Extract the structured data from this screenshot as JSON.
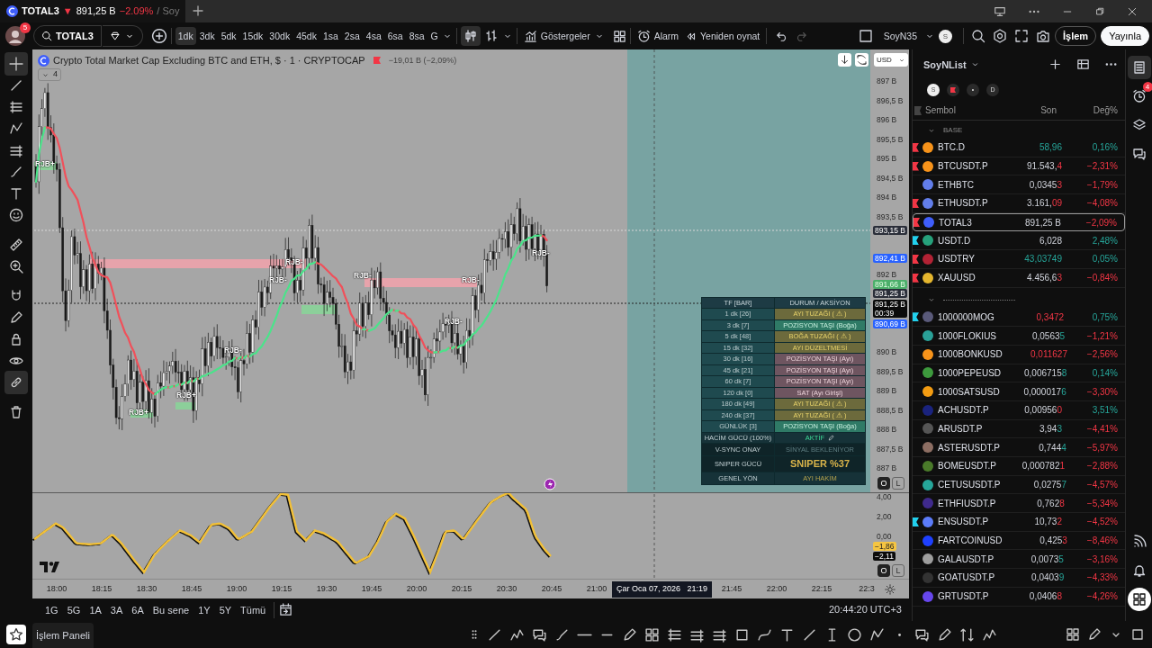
{
  "browser_tab": {
    "symbol": "TOTAL3",
    "arrow": "▼",
    "price": "891,25 B",
    "change": "−2.09%",
    "suffix": "/ Soy"
  },
  "header": {
    "avatar_badge": "5",
    "symbol": "TOTAL3",
    "timeframes": [
      {
        "label": "1dk",
        "selected": true
      },
      {
        "label": "3dk",
        "selected": false
      },
      {
        "label": "5dk",
        "selected": false
      },
      {
        "label": "15dk",
        "selected": false
      },
      {
        "label": "30dk",
        "selected": false
      },
      {
        "label": "45dk",
        "selected": false
      },
      {
        "label": "1sa",
        "selected": false
      },
      {
        "label": "2sa",
        "selected": false
      },
      {
        "label": "4sa",
        "selected": false
      },
      {
        "label": "6sa",
        "selected": false
      },
      {
        "label": "8sa",
        "selected": false
      },
      {
        "label": "G",
        "selected": false
      }
    ],
    "chart_types": [
      {
        "kind": "candles",
        "selected": true
      },
      {
        "kind": "bars",
        "selected": false
      }
    ],
    "indicators": "Göstergeler",
    "alarm": "Alarm",
    "replay": "Yeniden oynat",
    "layout": "SoyN35",
    "layout_badge": "S",
    "trade": "İşlem",
    "publish": "Yayınla"
  },
  "tools": [
    {
      "kind": "crosshair",
      "selected": true
    },
    {
      "kind": "trendline",
      "selected": false
    },
    {
      "kind": "fib",
      "selected": false
    },
    {
      "kind": "pattern",
      "selected": false
    },
    {
      "kind": "lines",
      "selected": false
    },
    {
      "kind": "brush",
      "selected": false
    },
    {
      "kind": "text",
      "selected": false
    },
    {
      "kind": "emoji",
      "selected": false
    },
    {
      "kind": "ruler",
      "selected": false
    },
    {
      "kind": "zoom",
      "selected": false
    },
    {
      "kind": "magnet",
      "selected": false
    },
    {
      "kind": "pencil",
      "selected": false
    },
    {
      "kind": "lock",
      "selected": false
    },
    {
      "kind": "eye",
      "selected": false
    },
    {
      "kind": "link",
      "selected": true
    },
    {
      "kind": "trash",
      "selected": false
    }
  ],
  "chart": {
    "title": "Crypto Total Market Cap Excluding BTC and ETH, $ · 1 · CRYPTOCAP",
    "change": "−19,01 B (−2,09%)",
    "collapsed_count": "4",
    "currency": "USD",
    "price_axis": [
      "897 B",
      "896,5 B",
      "896 B",
      "895,5 B",
      "895 B",
      "894,5 B",
      "894 B",
      "893,5 B",
      "892 B",
      "890 B",
      "889,5 B",
      "889 B",
      "888,5 B",
      "888 B",
      "887,5 B",
      "887 B"
    ],
    "price_tags": [
      {
        "text": "893,15 B",
        "kind": "dark"
      },
      {
        "text": "892,41 B",
        "kind": "blue"
      },
      {
        "text": "891,66 B",
        "kind": "green"
      },
      {
        "text": "891,25 B",
        "kind": "dark"
      },
      {
        "text": "891,25 B",
        "sub": "00:39",
        "kind": "black"
      },
      {
        "text": "890,69 B",
        "kind": "blue"
      }
    ],
    "markers": [
      "RJB+",
      "RJB-",
      "RJB-",
      "RJB-",
      "RJB-",
      "RJB-",
      "RJB-",
      "RJB-",
      "RJB+",
      "RJB+"
    ],
    "table": {
      "columns": [
        "TF [BAR]",
        "DURUM / AKSİYON"
      ],
      "rows": [
        {
          "tf": "1 dk [26]",
          "status": "AYI TUZAĞI ( ⚠ )",
          "kind": "warn"
        },
        {
          "tf": "3 dk [7]",
          "status": "POZİSYON TAŞI (Boğa)",
          "kind": "bull"
        },
        {
          "tf": "5 dk [48]",
          "status": "BOĞA TUZAĞI ( ⚠ )",
          "kind": "warn"
        },
        {
          "tf": "15 dk [32]",
          "status": "AYI DÜZELTMESİ",
          "kind": "warn"
        },
        {
          "tf": "30 dk [16]",
          "status": "POZİSYON TAŞI (Ayı)",
          "kind": "bear"
        },
        {
          "tf": "45 dk [21]",
          "status": "POZİSYON TAŞI (Ayı)",
          "kind": "bear"
        },
        {
          "tf": "60 dk [7]",
          "status": "POZİSYON TAŞI (Ayı)",
          "kind": "bear"
        },
        {
          "tf": "120 dk [0]",
          "status": "SAT (Ayı Girişi)",
          "kind": "bear"
        },
        {
          "tf": "180 dk [49]",
          "status": "AYI TUZAĞI ( ⚠ )",
          "kind": "warn"
        },
        {
          "tf": "240 dk [37]",
          "status": "AYI TUZAĞI ( ⚠ )",
          "kind": "warn"
        },
        {
          "tf": "GÜNLÜK [3]",
          "status": "POZİSYON TAŞI (Boğa)",
          "kind": "bull"
        },
        {
          "tf": "HACİM GÜCÜ (100%)",
          "status": "AKTİF",
          "kind": "active"
        },
        {
          "tf": "V-SYNC ONAY",
          "status": "SİNYAL BEKLENİYOR",
          "kind": "muted"
        },
        {
          "tf": "SNIPER GÜCÜ",
          "status": "SNIPER %37",
          "kind": "big"
        },
        {
          "tf": "GENEL YÖN",
          "status": "AYI HAKİM",
          "kind": "dim"
        }
      ]
    },
    "pane_buttons": [
      "O",
      "L"
    ],
    "osc_axis": [
      "4,00",
      "2,00",
      "0,00"
    ],
    "osc_tags": [
      {
        "text": "−1,86",
        "kind": "yellow"
      },
      {
        "text": "−2,11",
        "kind": "black"
      }
    ],
    "osc_buttons": [
      "O",
      "L"
    ],
    "time_axis": [
      "18:00",
      "18:15",
      "18:30",
      "18:45",
      "19:00",
      "19:15",
      "19:30",
      "19:45",
      "20:00",
      "20:15",
      "20:30",
      "20:45",
      "21:00",
      "21:45",
      "22:00",
      "22:15",
      "22:3"
    ],
    "crosshair_time": "Çar Oca 07, 2026   21:19"
  },
  "range_bar": {
    "ranges": [
      "1G",
      "5G",
      "1A",
      "3A",
      "6A",
      "Bu sene",
      "1Y",
      "5Y",
      "Tümü"
    ],
    "clock": "20:44:20 UTC+3"
  },
  "watchlist": {
    "title": "SoyNList",
    "filters": [
      {
        "kind": "letter",
        "text": "S",
        "selected": true
      },
      {
        "kind": "flag",
        "selected": false
      },
      {
        "kind": "letter",
        "text": "•",
        "selected": false
      },
      {
        "kind": "letter",
        "text": "D",
        "selected": false
      }
    ],
    "columns": [
      "Sembol",
      "Son",
      "Değ%"
    ],
    "groups": [
      {
        "kind": "titled",
        "title": "BASE",
        "expanded": true,
        "rows": [
          {
            "symbol": "BTC.D",
            "flag": {
              "color": "#f23645"
            },
            "color": "#f7931a",
            "price": {
              "tick": "58,96",
              "up": true
            },
            "change": "0,16%",
            "up": true,
            "selected": false
          },
          {
            "symbol": "BTCUSDT.P",
            "flag": {
              "color": "#f23645"
            },
            "color": "#f7931a",
            "price": {
              "text": "91.543,",
              "tick": "4",
              "up": false
            },
            "change": "−2,31%",
            "up": false,
            "selected": false
          },
          {
            "symbol": "ETHBTC",
            "color": "#627eea",
            "price": {
              "text": "0,0345",
              "tick": "3",
              "up": false
            },
            "change": "−1,79%",
            "up": false,
            "selected": false
          },
          {
            "symbol": "ETHUSDT.P",
            "flag": {
              "color": "#f23645"
            },
            "color": "#627eea",
            "price": {
              "text": "3.161,",
              "tick": "09",
              "up": false
            },
            "change": "−4,08%",
            "up": false,
            "selected": false
          },
          {
            "symbol": "TOTAL3",
            "flag": {
              "color": "#f23645"
            },
            "color": "#3f5efb",
            "price": {
              "text": "891,25 B"
            },
            "change": "−2,09%",
            "up": false,
            "selected": true
          },
          {
            "symbol": "USDT.D",
            "flag": {
              "color": "#22d1ee"
            },
            "color": "#26a17b",
            "price": {
              "text": "6,028"
            },
            "change": "2,48%",
            "up": true,
            "selected": false
          },
          {
            "symbol": "USDTRY",
            "flag": {
              "color": "#f23645"
            },
            "color": "#b22234",
            "price": {
              "tick": "43,03749",
              "up": true
            },
            "change": "0,05%",
            "up": true,
            "selected": false
          },
          {
            "symbol": "XAUUSD",
            "flag": {
              "color": "#f23645"
            },
            "color": "#e5b62e",
            "price": {
              "text": "4.456,6",
              "tick": "3",
              "up": false
            },
            "change": "−0,84%",
            "up": false,
            "selected": false
          }
        ]
      },
      {
        "kind": "separator",
        "expanded": true,
        "rows": [
          {
            "symbol": "1000000MOG",
            "flag": {
              "color": "#22d1ee"
            },
            "color": "#5a5a7a",
            "price": {
              "tick": "0,3472",
              "up": false
            },
            "change": "0,75%",
            "up": true,
            "selected": false
          },
          {
            "symbol": "1000FLOKIUS",
            "color": "#2aa198",
            "price": {
              "text": "0,0563",
              "tick": "5",
              "up": true
            },
            "change": "−1,21%",
            "up": false,
            "selected": false
          },
          {
            "symbol": "1000BONKUSD",
            "color": "#f7931a",
            "price": {
              "tick": "0,011627",
              "up": false
            },
            "change": "−2,56%",
            "up": false,
            "selected": false
          },
          {
            "symbol": "1000PEPEUSD",
            "color": "#3d9a3d",
            "price": {
              "text": "0,006715",
              "tick": "8",
              "up": true
            },
            "change": "0,14%",
            "up": true,
            "selected": false
          },
          {
            "symbol": "1000SATSUSD",
            "color": "#f39c12",
            "price": {
              "text": "0,000017",
              "tick": "6",
              "up": true
            },
            "change": "−3,30%",
            "up": false,
            "selected": false
          },
          {
            "symbol": "ACHUSDT.P",
            "color": "#1a237e",
            "price": {
              "text": "0,00956",
              "tick": "0",
              "up": false
            },
            "change": "3,51%",
            "up": true,
            "selected": false
          },
          {
            "symbol": "ARUSDT.P",
            "color": "#555555",
            "price": {
              "text": "3,94",
              "tick": "3",
              "up": true
            },
            "change": "−4,41%",
            "up": false,
            "selected": false
          },
          {
            "symbol": "ASTERUSDT.P",
            "color": "#8d6e63",
            "price": {
              "text": "0,744",
              "tick": "4",
              "up": true
            },
            "change": "−5,97%",
            "up": false,
            "selected": false
          },
          {
            "symbol": "BOMEUSDT.P",
            "color": "#4a7a2a",
            "price": {
              "text": "0,000782",
              "tick": "1",
              "up": false
            },
            "change": "−2,88%",
            "up": false,
            "selected": false
          },
          {
            "symbol": "CETUSUSDT.P",
            "color": "#26a69a",
            "price": {
              "text": "0,0275",
              "tick": "7",
              "up": true
            },
            "change": "−4,57%",
            "up": false,
            "selected": false
          },
          {
            "symbol": "ETHFIUSDT.P",
            "color": "#3f2a8c",
            "price": {
              "text": "0,762",
              "tick": "8",
              "up": false
            },
            "change": "−5,34%",
            "up": false,
            "selected": false
          },
          {
            "symbol": "ENSUSDT.P",
            "flag": {
              "color": "#22d1ee"
            },
            "color": "#5c7cfa",
            "price": {
              "text": "10,73",
              "tick": "2",
              "up": false
            },
            "change": "−4,52%",
            "up": false,
            "selected": false
          },
          {
            "symbol": "FARTCOINUSD",
            "color": "#1e40ff",
            "price": {
              "text": "0,425",
              "tick": "3",
              "up": false
            },
            "change": "−8,46%",
            "up": false,
            "selected": false
          },
          {
            "symbol": "GALAUSDT.P",
            "color": "#9e9e9e",
            "price": {
              "text": "0,0073",
              "tick": "5",
              "up": true
            },
            "change": "−3,16%",
            "up": false,
            "selected": false
          },
          {
            "symbol": "GOATUSDT.P",
            "color": "#333333",
            "price": {
              "text": "0,0403",
              "tick": "9",
              "up": true
            },
            "change": "−4,33%",
            "up": false,
            "selected": false
          },
          {
            "symbol": "GRTUSDT.P",
            "color": "#6747ed",
            "price": {
              "text": "0,0406",
              "tick": "8",
              "up": false
            },
            "change": "−4,26%",
            "up": false,
            "selected": false
          }
        ]
      }
    ]
  },
  "side_strip": [
    {
      "kind": "watchlist",
      "selected": true
    },
    {
      "kind": "alarms",
      "selected": false,
      "badge": "4"
    },
    {
      "kind": "layers",
      "selected": false
    },
    {
      "kind": "chat",
      "selected": false
    },
    {
      "kind": "signal",
      "selected": false
    },
    {
      "kind": "bell",
      "selected": false
    },
    {
      "kind": "apps",
      "selected": false
    }
  ],
  "bottom": {
    "panel": "İşlem Paneli"
  }
}
